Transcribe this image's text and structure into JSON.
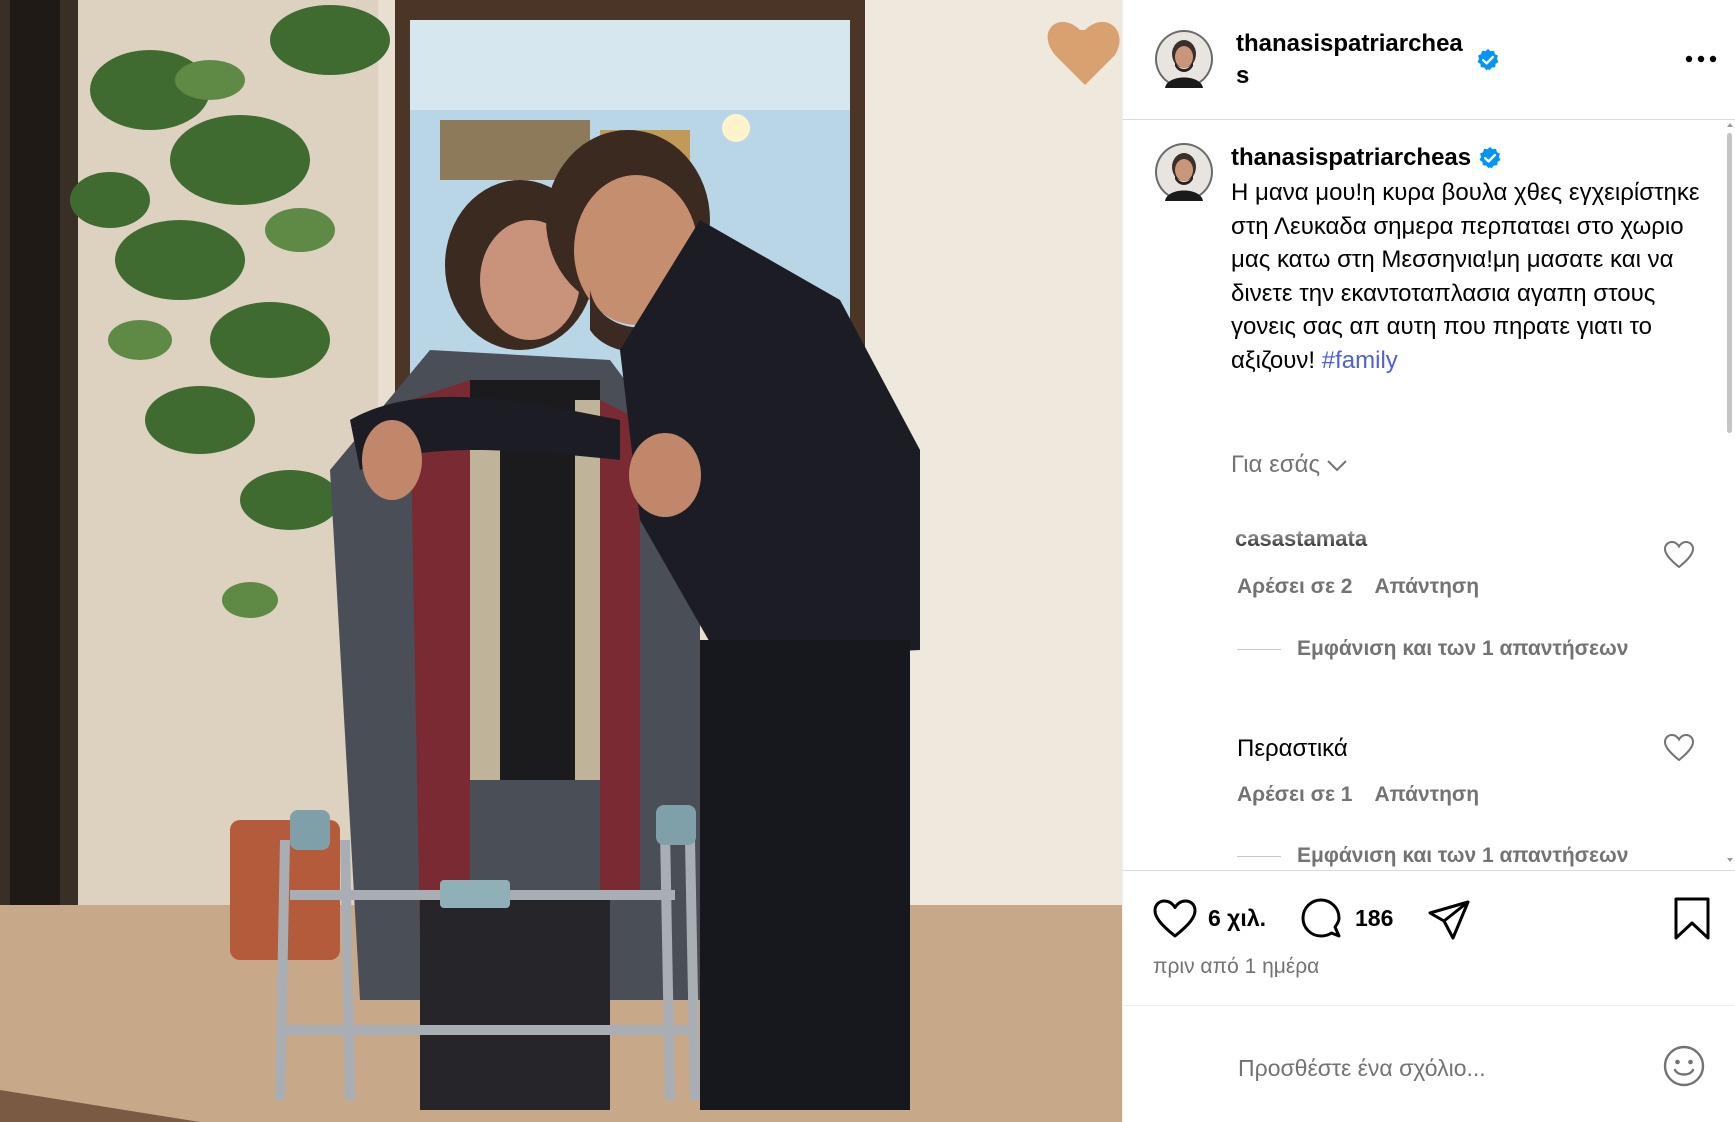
{
  "post": {
    "username": "thanasispatriarcheas",
    "caption": "Η μανα μου!η κυρα βουλα χθες εγχειρίστηκε στη Λευκαδα σημερα περπαταει στο χωριο μας κατω στη Μεσσηνια!μη μασατε και να δινετε την εκαντοταπλασια αγαπη στους γονεις σας απ αυτη που πηρατε γιατι το αξιζουν!",
    "hashtag": "#family",
    "translate_label": "Για εσάς",
    "likes": "6 χιλ.",
    "comments_count": "186",
    "timestamp": "πριν από 1 ημέρα",
    "accent_color": "#0095f6"
  },
  "comments": [
    {
      "user_partial": "casastamata",
      "text": "",
      "likes_label": "Αρέσει σε 2",
      "reply_label": "Απάντηση",
      "view_replies": "Εμφάνιση και των 1 απαντήσεων"
    },
    {
      "user_partial": "",
      "text": "Περαστικά",
      "likes_label": "Αρέσει σε 1",
      "reply_label": "Απάντηση",
      "view_replies": "Εμφάνιση και των 1 απαντήσεων"
    }
  ],
  "composer": {
    "placeholder": "Προσθέστε ένα σχόλιο..."
  },
  "icons": [
    "more-icon",
    "verified-icon",
    "heart-icon",
    "comment-icon",
    "share-icon",
    "bookmark-icon",
    "emoji-icon",
    "chevron-down-icon"
  ]
}
